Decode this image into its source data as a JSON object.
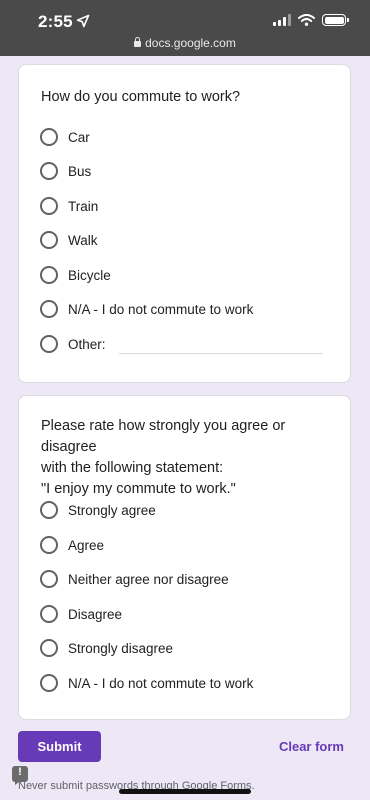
{
  "status_bar": {
    "time": "2:55",
    "url": "docs.google.com"
  },
  "question1": {
    "title": "How do you commute to work?",
    "options": [
      "Car",
      "Bus",
      "Train",
      "Walk",
      "Bicycle",
      "N/A - I do not commute to work",
      "Other:"
    ]
  },
  "question2": {
    "title_lines": [
      "Please rate how strongly you agree or disagree",
      "with the following statement:",
      "\"I enjoy my commute to work.\""
    ],
    "options": [
      "Strongly agree",
      "Agree",
      "Neither agree nor disagree",
      "Disagree",
      "Strongly disagree",
      "N/A - I do not commute to work"
    ]
  },
  "actions": {
    "submit_label": "Submit",
    "clear_label": "Clear form"
  },
  "footer": {
    "note": "Never submit passwords through Google Forms."
  }
}
